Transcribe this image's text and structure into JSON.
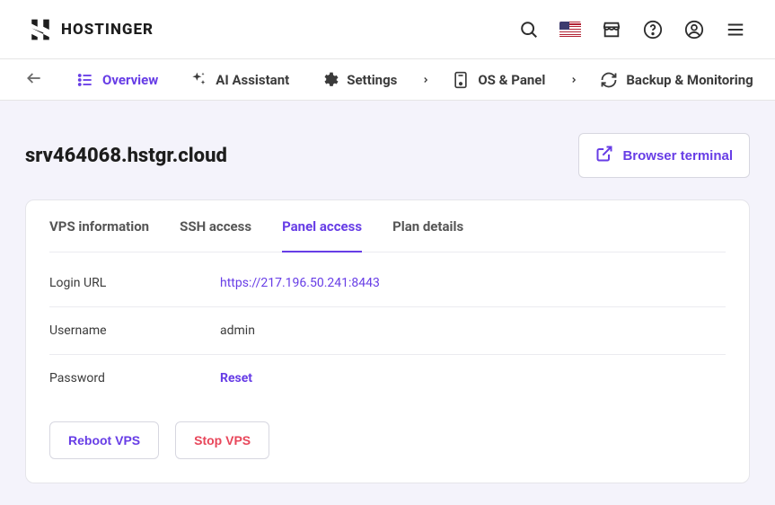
{
  "header": {
    "brand": "HOSTINGER"
  },
  "nav": {
    "overview": "Overview",
    "ai_assistant": "AI Assistant",
    "settings": "Settings",
    "os_panel": "OS & Panel",
    "backup_monitoring": "Backup & Monitoring"
  },
  "page": {
    "title": "srv464068.hstgr.cloud",
    "browser_terminal": "Browser terminal"
  },
  "tabs": {
    "vps_info": "VPS information",
    "ssh_access": "SSH access",
    "panel_access": "Panel access",
    "plan_details": "Plan details"
  },
  "panel": {
    "login_url_label": "Login URL",
    "login_url_value": "https://217.196.50.241:8443",
    "username_label": "Username",
    "username_value": "admin",
    "password_label": "Password",
    "password_action": "Reset"
  },
  "buttons": {
    "reboot": "Reboot VPS",
    "stop": "Stop VPS"
  }
}
